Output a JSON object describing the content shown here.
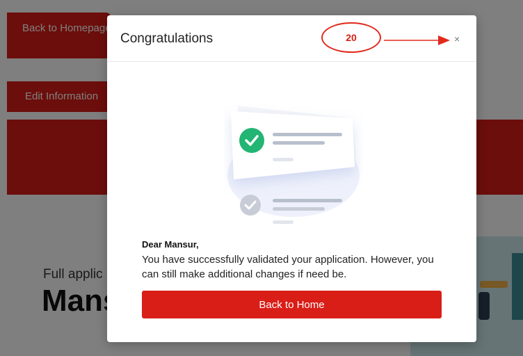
{
  "background": {
    "nav_back_label": "Back to Homepage",
    "nav_edit_label": "Edit Information",
    "hero_label": "Full applic",
    "hero_name": "Mans"
  },
  "modal": {
    "title": "Congratulations",
    "close_symbol": "×",
    "annotation_number": "20",
    "greeting": "Dear Mansur,",
    "message": "You have successfully validated your application. However, you can still make additional changes if need be.",
    "primary_button_label": "Back to Home"
  },
  "colors": {
    "brand_red": "#d91d17",
    "success_green": "#22b573",
    "annotation_red": "#e02a1c"
  }
}
